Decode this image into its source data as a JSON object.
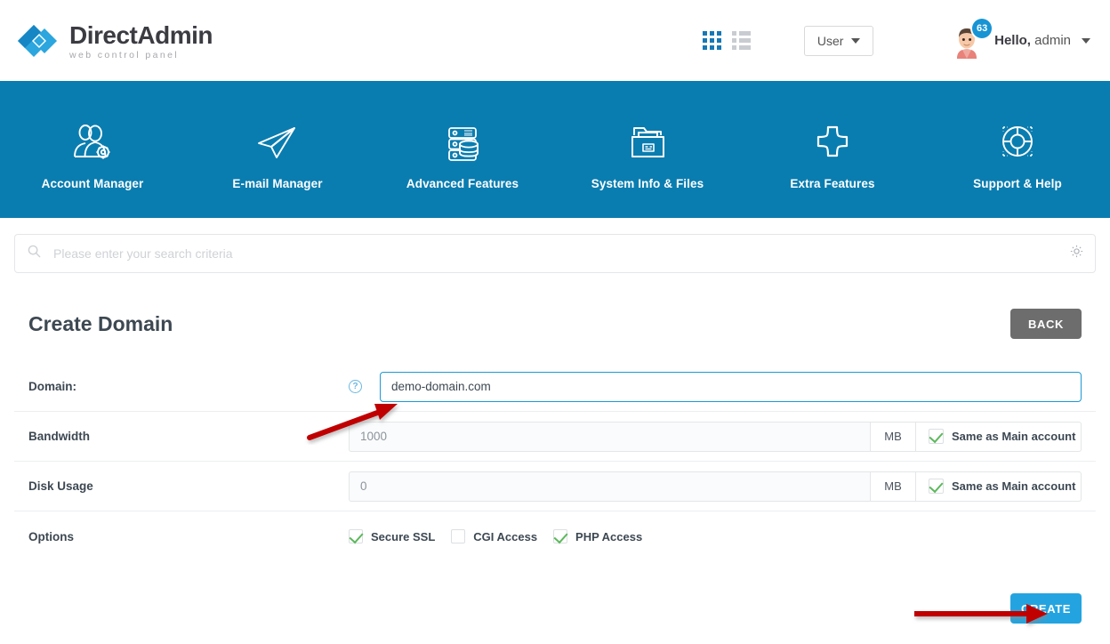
{
  "brand": {
    "title": "DirectAdmin",
    "subtitle": "web control panel"
  },
  "header": {
    "view_grid_icon": "grid-view-icon",
    "view_list_icon": "list-view-icon",
    "user_select_label": "User",
    "notification_count": "63",
    "greeting_bold": "Hello,",
    "greeting_name": "admin",
    "accent_color": "#1678b4"
  },
  "nav": {
    "background_color": "#0a7db0",
    "items": [
      {
        "label": "Account Manager",
        "icon": "users-gear-icon"
      },
      {
        "label": "E-mail Manager",
        "icon": "paper-plane-icon"
      },
      {
        "label": "Advanced Features",
        "icon": "server-database-icon"
      },
      {
        "label": "System Info & Files",
        "icon": "file-folder-icon"
      },
      {
        "label": "Extra Features",
        "icon": "plus-icon"
      },
      {
        "label": "Support & Help",
        "icon": "life-ring-icon"
      }
    ]
  },
  "search": {
    "placeholder": "Please enter your search criteria",
    "value": "",
    "icon": "search-icon",
    "settings_icon": "gear-icon"
  },
  "page": {
    "title": "Create Domain",
    "back_label": "BACK",
    "create_label": "CREATE",
    "create_color": "#23a4e0",
    "back_color": "#6d6d6d"
  },
  "form": {
    "domain": {
      "label": "Domain:",
      "help_icon": "help-question-icon",
      "value": "demo-domain.com",
      "placeholder": ""
    },
    "bandwidth": {
      "label": "Bandwidth",
      "value": "1000",
      "unit": "MB",
      "same_as_main_label": "Same as Main account",
      "same_as_main_checked": true
    },
    "disk_usage": {
      "label": "Disk Usage",
      "value": "0",
      "unit": "MB",
      "same_as_main_label": "Same as Main account",
      "same_as_main_checked": true
    },
    "options": {
      "label": "Options",
      "items": [
        {
          "label": "Secure SSL",
          "checked": true
        },
        {
          "label": "CGI Access",
          "checked": false
        },
        {
          "label": "PHP Access",
          "checked": true
        }
      ]
    }
  },
  "annotations": {
    "arrow_color": "#c00000",
    "arrow_domain_target": "domain-input",
    "arrow_create_target": "create-button"
  }
}
